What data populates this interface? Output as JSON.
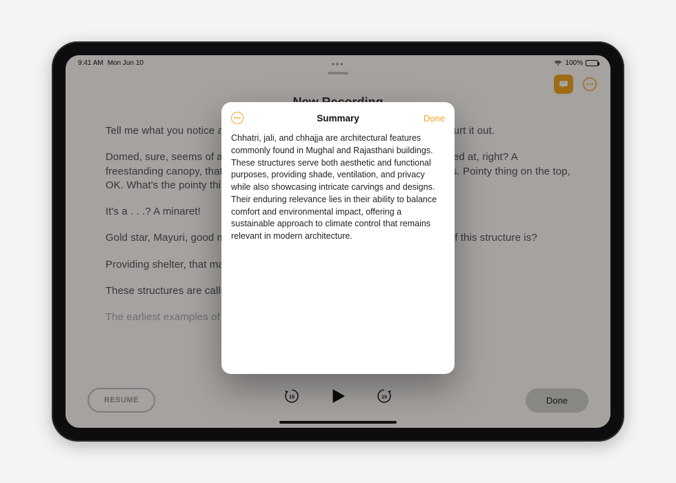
{
  "status": {
    "time": "9:41 AM",
    "date": "Mon Jun 10",
    "battery_pct": "100%"
  },
  "page": {
    "title": "New Recording"
  },
  "transcript": {
    "p1": "Tell me what you notice about this slide. No need to raise your hand, just blurt it out.",
    "p2": "Domed, sure, seems of a piece with some of the other buildings we've looked at, right? A freestanding canopy, that's right. There are some pillars, some fine carvings. Pointy thing on the top, OK. What's the pointy thing on top called?",
    "p3": "It's a . . .? A minaret!",
    "p4": "Gold star, Mayuri, good memory. OK, so what do we imagine the purpose of this structure is?",
    "p5": "Providing shelter, that makes sense, you're absolutely correct.",
    "p6": "These structures are called chhatri, which means",
    "p7": "The earliest examples of these are from Gujarat, but we"
  },
  "controls": {
    "resume_label": "RESUME",
    "done_label": "Done",
    "skip_back_label": "15",
    "skip_fwd_label": "15"
  },
  "sheet": {
    "title": "Summary",
    "done_label": "Done",
    "body": "Chhatri, jali, and chhajja are architectural features commonly found in Mughal and Rajasthani buildings. These structures serve both aesthetic and functional purposes, providing shade, ventilation, and privacy while also showcasing intricate carvings and designs. Their enduring relevance lies in their ability to balance comfort and environmental impact, offering a sustainable approach to climate control that remains relevant in modern architecture."
  }
}
